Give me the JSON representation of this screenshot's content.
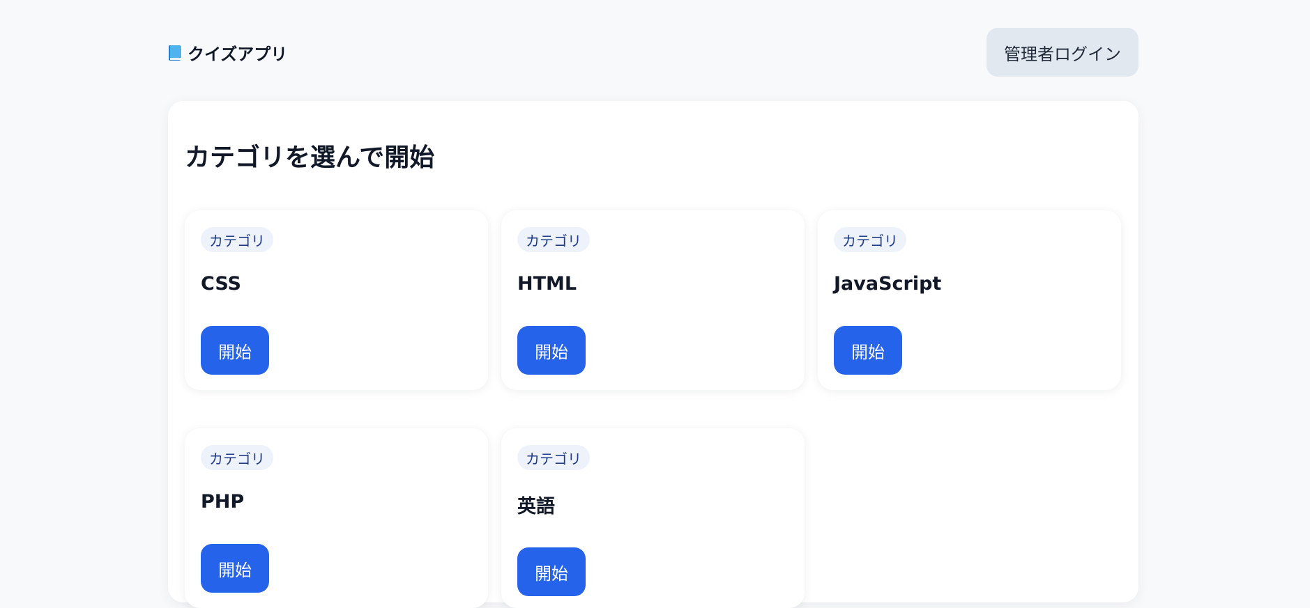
{
  "header": {
    "app_title": "クイズアプリ",
    "admin_login_label": "管理者ログイン",
    "brand_icon": "book-icon"
  },
  "main": {
    "heading": "カテゴリを選んで開始",
    "cards": [
      {
        "chip": "カテゴリ",
        "title": "CSS",
        "button": "開始"
      },
      {
        "chip": "カテゴリ",
        "title": "HTML",
        "button": "開始"
      },
      {
        "chip": "カテゴリ",
        "title": "JavaScript",
        "button": "開始"
      },
      {
        "chip": "カテゴリ",
        "title": "PHP",
        "button": "開始"
      },
      {
        "chip": "カテゴリ",
        "title": "英語",
        "button": "開始"
      }
    ]
  },
  "colors": {
    "background": "#f8f9fb",
    "accent": "#2563eb",
    "chip_background": "#eef2fb",
    "chip_text": "#1e3a8a",
    "admin_button": "#e2e8f0"
  }
}
